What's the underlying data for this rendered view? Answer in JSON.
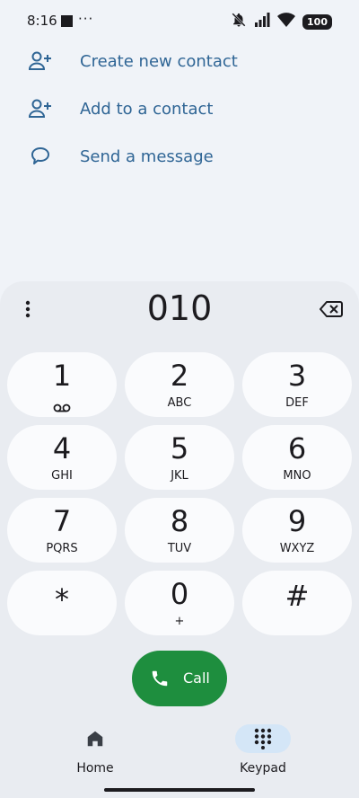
{
  "status": {
    "time": "8:16",
    "overflow": "···",
    "battery": "100",
    "icons": [
      "notifications-off-icon",
      "signal-icon",
      "wifi-icon",
      "battery-icon"
    ]
  },
  "actions": [
    {
      "label": "Create new contact",
      "icon": "person-add-icon"
    },
    {
      "label": "Add to a contact",
      "icon": "person-add-icon"
    },
    {
      "label": "Send a message",
      "icon": "message-icon"
    }
  ],
  "dialer": {
    "number": "010",
    "keys": [
      {
        "digit": "1",
        "letters": ""
      },
      {
        "digit": "2",
        "letters": "ABC"
      },
      {
        "digit": "3",
        "letters": "DEF"
      },
      {
        "digit": "4",
        "letters": "GHI"
      },
      {
        "digit": "5",
        "letters": "JKL"
      },
      {
        "digit": "6",
        "letters": "MNO"
      },
      {
        "digit": "7",
        "letters": "PQRS"
      },
      {
        "digit": "8",
        "letters": "TUV"
      },
      {
        "digit": "9",
        "letters": "WXYZ"
      },
      {
        "digit": "*",
        "letters": ""
      },
      {
        "digit": "0",
        "letters": "+"
      },
      {
        "digit": "#",
        "letters": ""
      }
    ],
    "call_label": "Call"
  },
  "nav": {
    "home": "Home",
    "keypad": "Keypad",
    "active": "keypad"
  },
  "colors": {
    "accent_text": "#2f6595",
    "call_green": "#1e8e3e",
    "nav_active_pill": "#d4e6f7"
  }
}
